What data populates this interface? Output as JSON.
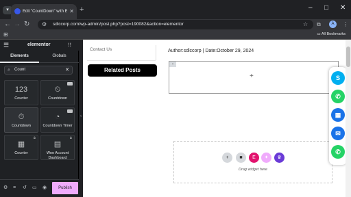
{
  "browser": {
    "tab_title": "Edit \"CountDown\" with Elementor",
    "tab_menu_icon": "chevron-down-icon",
    "newtab_icon": "plus-icon",
    "window_controls": [
      "–",
      "□",
      "✕"
    ],
    "url": "sdlccorp.com/wp-admin/post.php?post=190082&action=elementor",
    "profile_initial": "A",
    "bookmarks_label": "All Bookmarks"
  },
  "panel": {
    "logo": "elementor",
    "tabs": [
      "Elements",
      "Globals"
    ],
    "search_value": "Count",
    "widgets": [
      {
        "label": "Counter",
        "icon": "123",
        "pro": false,
        "locked": false
      },
      {
        "label": "Countdown",
        "icon": "countdown-icon",
        "pro": true,
        "locked": false
      },
      {
        "label": "Countdown",
        "icon": "pointer-icon",
        "pro": false,
        "locked": false
      },
      {
        "label": "Countdown Timer",
        "icon": "timer-icon",
        "pro": true,
        "locked": false
      },
      {
        "label": "Counter",
        "icon": "counter-icon",
        "pro": false,
        "locked": true
      },
      {
        "label": "Woo Account Dashboard",
        "icon": "account-icon",
        "pro": false,
        "locked": true
      }
    ],
    "publish_label": "Publish"
  },
  "canvas": {
    "contact_text": "Contact Us",
    "author_text": "Author:sdlccorp  |  Date:October 29, 2024",
    "related_posts": "Related Posts",
    "drag_label": "Drag widget here"
  },
  "colors": {
    "publish_bg": "#f0abfc",
    "floatbar_skype": "#00aff0",
    "floatbar_whatsapp": "#25d366",
    "floatbar_calendar": "#1a73e8",
    "floatbar_email": "#1a73e8",
    "floatbar_phone": "#25d366"
  }
}
